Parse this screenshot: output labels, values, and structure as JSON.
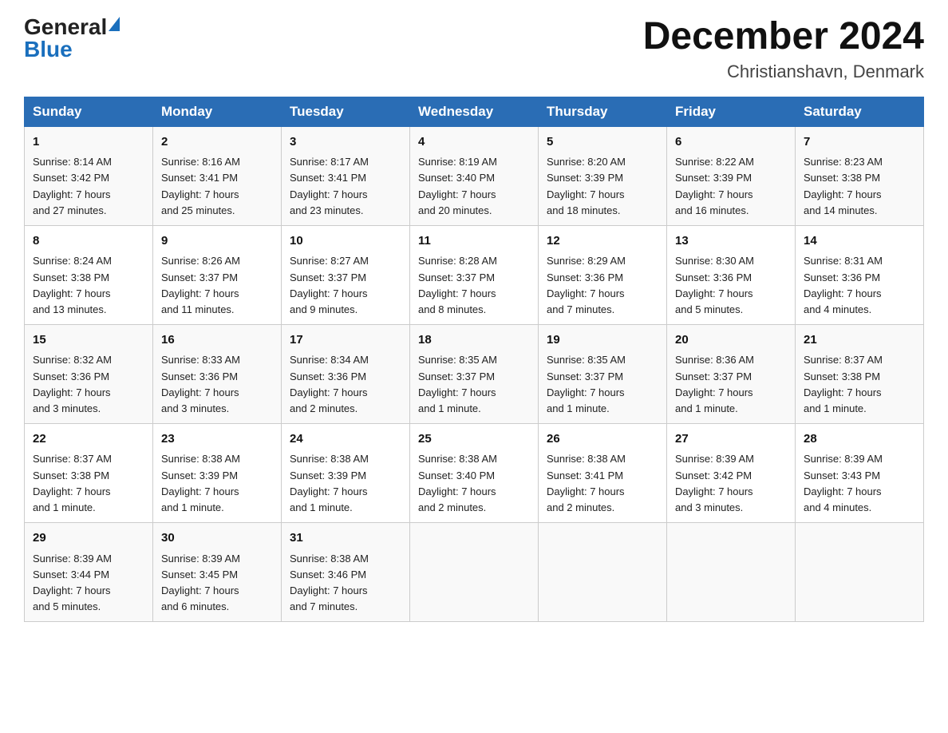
{
  "header": {
    "logo_general": "General",
    "logo_blue": "Blue",
    "month_title": "December 2024",
    "location": "Christianshavn, Denmark"
  },
  "days_of_week": [
    "Sunday",
    "Monday",
    "Tuesday",
    "Wednesday",
    "Thursday",
    "Friday",
    "Saturday"
  ],
  "weeks": [
    [
      {
        "day": "1",
        "sunrise": "8:14 AM",
        "sunset": "3:42 PM",
        "daylight": "7 hours and 27 minutes."
      },
      {
        "day": "2",
        "sunrise": "8:16 AM",
        "sunset": "3:41 PM",
        "daylight": "7 hours and 25 minutes."
      },
      {
        "day": "3",
        "sunrise": "8:17 AM",
        "sunset": "3:41 PM",
        "daylight": "7 hours and 23 minutes."
      },
      {
        "day": "4",
        "sunrise": "8:19 AM",
        "sunset": "3:40 PM",
        "daylight": "7 hours and 20 minutes."
      },
      {
        "day": "5",
        "sunrise": "8:20 AM",
        "sunset": "3:39 PM",
        "daylight": "7 hours and 18 minutes."
      },
      {
        "day": "6",
        "sunrise": "8:22 AM",
        "sunset": "3:39 PM",
        "daylight": "7 hours and 16 minutes."
      },
      {
        "day": "7",
        "sunrise": "8:23 AM",
        "sunset": "3:38 PM",
        "daylight": "7 hours and 14 minutes."
      }
    ],
    [
      {
        "day": "8",
        "sunrise": "8:24 AM",
        "sunset": "3:38 PM",
        "daylight": "7 hours and 13 minutes."
      },
      {
        "day": "9",
        "sunrise": "8:26 AM",
        "sunset": "3:37 PM",
        "daylight": "7 hours and 11 minutes."
      },
      {
        "day": "10",
        "sunrise": "8:27 AM",
        "sunset": "3:37 PM",
        "daylight": "7 hours and 9 minutes."
      },
      {
        "day": "11",
        "sunrise": "8:28 AM",
        "sunset": "3:37 PM",
        "daylight": "7 hours and 8 minutes."
      },
      {
        "day": "12",
        "sunrise": "8:29 AM",
        "sunset": "3:36 PM",
        "daylight": "7 hours and 7 minutes."
      },
      {
        "day": "13",
        "sunrise": "8:30 AM",
        "sunset": "3:36 PM",
        "daylight": "7 hours and 5 minutes."
      },
      {
        "day": "14",
        "sunrise": "8:31 AM",
        "sunset": "3:36 PM",
        "daylight": "7 hours and 4 minutes."
      }
    ],
    [
      {
        "day": "15",
        "sunrise": "8:32 AM",
        "sunset": "3:36 PM",
        "daylight": "7 hours and 3 minutes."
      },
      {
        "day": "16",
        "sunrise": "8:33 AM",
        "sunset": "3:36 PM",
        "daylight": "7 hours and 3 minutes."
      },
      {
        "day": "17",
        "sunrise": "8:34 AM",
        "sunset": "3:36 PM",
        "daylight": "7 hours and 2 minutes."
      },
      {
        "day": "18",
        "sunrise": "8:35 AM",
        "sunset": "3:37 PM",
        "daylight": "7 hours and 1 minute."
      },
      {
        "day": "19",
        "sunrise": "8:35 AM",
        "sunset": "3:37 PM",
        "daylight": "7 hours and 1 minute."
      },
      {
        "day": "20",
        "sunrise": "8:36 AM",
        "sunset": "3:37 PM",
        "daylight": "7 hours and 1 minute."
      },
      {
        "day": "21",
        "sunrise": "8:37 AM",
        "sunset": "3:38 PM",
        "daylight": "7 hours and 1 minute."
      }
    ],
    [
      {
        "day": "22",
        "sunrise": "8:37 AM",
        "sunset": "3:38 PM",
        "daylight": "7 hours and 1 minute."
      },
      {
        "day": "23",
        "sunrise": "8:38 AM",
        "sunset": "3:39 PM",
        "daylight": "7 hours and 1 minute."
      },
      {
        "day": "24",
        "sunrise": "8:38 AM",
        "sunset": "3:39 PM",
        "daylight": "7 hours and 1 minute."
      },
      {
        "day": "25",
        "sunrise": "8:38 AM",
        "sunset": "3:40 PM",
        "daylight": "7 hours and 2 minutes."
      },
      {
        "day": "26",
        "sunrise": "8:38 AM",
        "sunset": "3:41 PM",
        "daylight": "7 hours and 2 minutes."
      },
      {
        "day": "27",
        "sunrise": "8:39 AM",
        "sunset": "3:42 PM",
        "daylight": "7 hours and 3 minutes."
      },
      {
        "day": "28",
        "sunrise": "8:39 AM",
        "sunset": "3:43 PM",
        "daylight": "7 hours and 4 minutes."
      }
    ],
    [
      {
        "day": "29",
        "sunrise": "8:39 AM",
        "sunset": "3:44 PM",
        "daylight": "7 hours and 5 minutes."
      },
      {
        "day": "30",
        "sunrise": "8:39 AM",
        "sunset": "3:45 PM",
        "daylight": "7 hours and 6 minutes."
      },
      {
        "day": "31",
        "sunrise": "8:38 AM",
        "sunset": "3:46 PM",
        "daylight": "7 hours and 7 minutes."
      },
      null,
      null,
      null,
      null
    ]
  ],
  "labels": {
    "sunrise": "Sunrise:",
    "sunset": "Sunset:",
    "daylight": "Daylight:"
  }
}
